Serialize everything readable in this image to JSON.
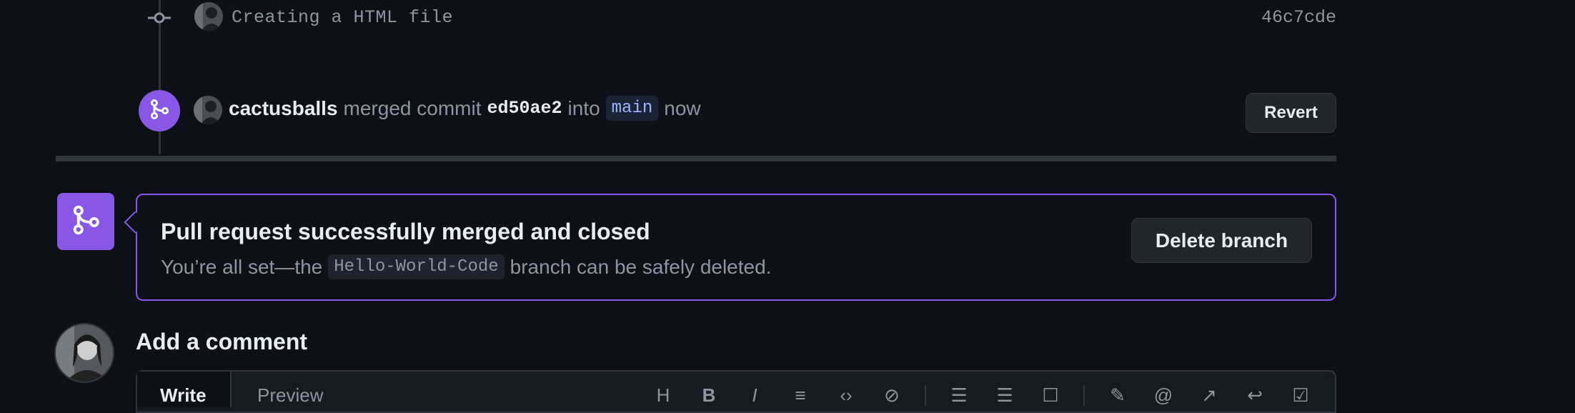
{
  "commit": {
    "message": "Creating a HTML file",
    "sha": "46c7cde"
  },
  "merge_event": {
    "user": "cactusballs",
    "action": "merged commit",
    "commit_sha": "ed50ae2",
    "into_text": "into",
    "branch": "main",
    "time": "now",
    "revert_label": "Revert"
  },
  "merged_panel": {
    "title": "Pull request successfully merged and closed",
    "desc_before": "You’re all set—the",
    "branch": "Hello-World-Code",
    "desc_after": "branch can be safely deleted.",
    "delete_label": "Delete branch"
  },
  "comment": {
    "title": "Add a comment",
    "tabs": [
      "Write",
      "Preview"
    ],
    "toolbar_icons": [
      "heading-icon",
      "bold-icon",
      "italic-icon",
      "quote-icon",
      "code-icon",
      "link-icon",
      "ordered-list-icon",
      "unordered-list-icon",
      "task-list-icon",
      "attach-icon",
      "mention-icon",
      "reference-icon",
      "reply-icon",
      "slash-command-icon"
    ]
  },
  "colors": {
    "background": "#0d1117",
    "accent_merged": "#8957e5",
    "border": "#30363d",
    "muted_text": "#8d96a0"
  }
}
